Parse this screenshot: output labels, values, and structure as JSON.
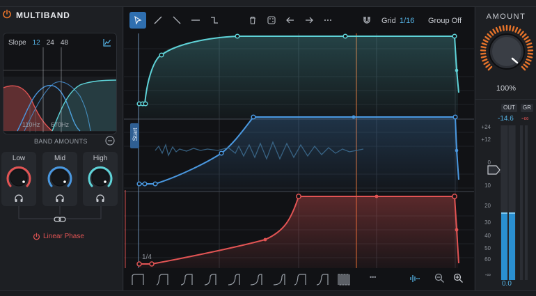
{
  "multiband": {
    "title": "MULTIBAND",
    "slope_label": "Slope",
    "slope_options": [
      "12",
      "24",
      "48"
    ],
    "slope_selected": "12",
    "crossover_freqs": [
      "110Hz",
      "670Hz"
    ],
    "band_amounts_title": "BAND AMOUNTS",
    "bands": [
      {
        "label": "Low",
        "color": "#e25454"
      },
      {
        "label": "Mid",
        "color": "#4a98e0"
      },
      {
        "label": "High",
        "color": "#5fd3d8"
      }
    ],
    "linear_phase_label": "Linear Phase",
    "accent_color": "#e8742a"
  },
  "toolbar": {
    "tools": [
      "pointer-tool",
      "line-up-tool",
      "line-down-tool",
      "flat-tool",
      "step-tool",
      "delete-tool",
      "random-tool",
      "undo-tool",
      "redo-tool",
      "more-tool",
      "magnet-tool"
    ],
    "grid_label": "Grid",
    "grid_value": "1/16",
    "group_label": "Group Off",
    "active_color": "#2f6fb0"
  },
  "canvas": {
    "start_label": "Start",
    "loop_label": "1/4",
    "lanes": [
      {
        "name": "high",
        "color": "#5fd3d8"
      },
      {
        "name": "mid",
        "color": "#4a98e0"
      },
      {
        "name": "low",
        "color": "#e25454"
      }
    ]
  },
  "bottom_bar": {
    "shape_presets": [
      "shape-1",
      "shape-2",
      "shape-3",
      "shape-4",
      "shape-5",
      "shape-6",
      "shape-7",
      "shape-8",
      "shape-9",
      "shape-10"
    ],
    "more_label": "•••"
  },
  "output": {
    "amount_title": "AMOUNT",
    "amount_value": "100%",
    "amount_level": 1.0,
    "out_tab": "OUT",
    "gr_tab": "GR",
    "out_value": "-14.6",
    "gr_value": "-∞",
    "scale": [
      "+24",
      "+12",
      "0",
      "10",
      "20",
      "30",
      "40",
      "50",
      "60",
      "-∞"
    ],
    "meter_reading": "0.0",
    "knob_color": "#e8742a"
  }
}
